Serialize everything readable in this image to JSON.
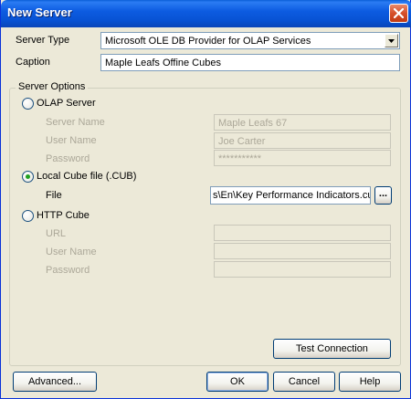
{
  "window": {
    "title": "New Server"
  },
  "form": {
    "server_type_label": "Server Type",
    "server_type_value": "Microsoft OLE DB Provider for OLAP Services",
    "caption_label": "Caption",
    "caption_value": "Maple Leafs Offine Cubes"
  },
  "server_options": {
    "legend": "Server Options",
    "olap": {
      "radio_label": "OLAP Server",
      "selected": false,
      "server_name_label": "Server Name",
      "server_name_value": "Maple Leafs 67",
      "user_name_label": "User Name",
      "user_name_value": "Joe Carter",
      "password_label": "Password",
      "password_value": "***********"
    },
    "local_cube": {
      "radio_label": "Local Cube file (.CUB)",
      "selected": true,
      "file_label": "File",
      "file_value": "s\\En\\Key Performance Indicators.cub",
      "browse_label": "..."
    },
    "http": {
      "radio_label": "HTTP Cube",
      "selected": false,
      "url_label": "URL",
      "user_name_label": "User Name",
      "password_label": "Password"
    },
    "test_connection_label": "Test Connection"
  },
  "buttons": {
    "advanced": "Advanced...",
    "ok": "OK",
    "cancel": "Cancel",
    "help": "Help"
  }
}
